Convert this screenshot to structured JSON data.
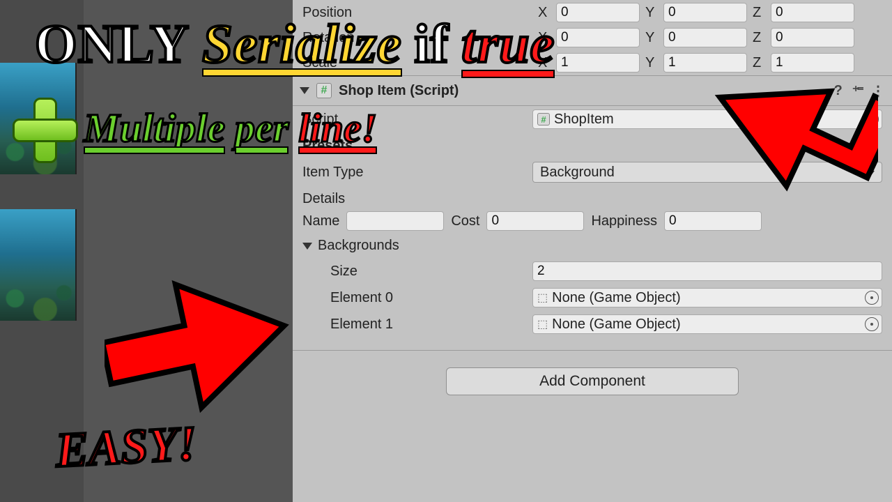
{
  "transform": {
    "position": {
      "label": "Position",
      "x": "0",
      "y": "0",
      "z": "0"
    },
    "rotation": {
      "label": "Rotation",
      "x": "0",
      "y": "0",
      "z": "0"
    },
    "scale": {
      "label": "Scale",
      "x": "1",
      "y": "1",
      "z": "1"
    }
  },
  "component": {
    "title": "Shop Item (Script)",
    "script_label": "Script",
    "script_value": "ShopItem",
    "presets_label": "Presets",
    "item_type_label": "Item Type",
    "item_type_value": "Background",
    "details_header": "Details",
    "details": {
      "name_label": "Name",
      "name_value": "",
      "cost_label": "Cost",
      "cost_value": "0",
      "happiness_label": "Happiness",
      "happiness_value": "0"
    },
    "backgrounds": {
      "header": "Backgrounds",
      "size_label": "Size",
      "size_value": "2",
      "elements": [
        {
          "label": "Element 0",
          "value": "None (Game Object)"
        },
        {
          "label": "Element 1",
          "value": "None (Game Object)"
        }
      ]
    }
  },
  "add_component": "Add Component",
  "axis": {
    "x": "X",
    "y": "Y",
    "z": "Z"
  },
  "overlay": {
    "only": "ONLY",
    "serialize": "Serialize",
    "if": "if",
    "true": "true",
    "multiple": "Multiple",
    "per": "per",
    "line": "line!",
    "easy": "EASY!"
  }
}
